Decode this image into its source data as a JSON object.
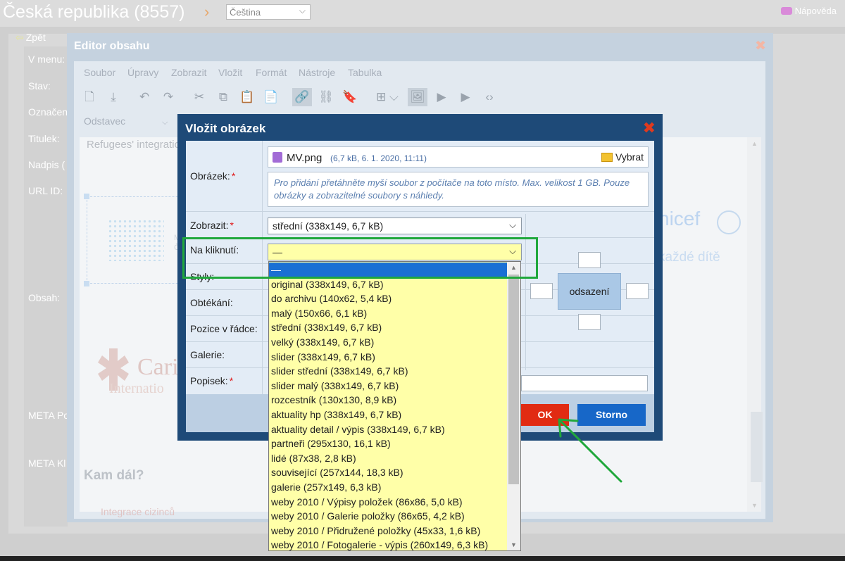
{
  "topbar": {
    "title": "Česká republika (8557)",
    "language": "Čeština",
    "help": "Nápověda"
  },
  "page": {
    "back": "Zpět",
    "labels": [
      "V menu:",
      "Stav:",
      "Označen",
      "Titulek:",
      "Nadpis (",
      "URL ID:",
      "Obsah:",
      "META Po",
      "META Kl"
    ]
  },
  "editor": {
    "title": "Editor obsahu",
    "menu": [
      "Soubor",
      "Úpravy",
      "Zobrazit",
      "Vložit",
      "Formát",
      "Nástroje",
      "Tabulka"
    ],
    "format": "Odstavec",
    "content_text": "Refugees' integratio",
    "mv_logo_text_1": "MI",
    "mv_logo_text_2": "ČE",
    "unicef": "nicef",
    "unicef_sub": "každé dítě",
    "caritas": "Cari",
    "caritas_sub": "Internatio",
    "heading": "Kam dál?",
    "link": "Integrace cizinců"
  },
  "dialog": {
    "title": "Vložit obrázek",
    "labels": {
      "image": "Obrázek:",
      "display": "Zobrazit:",
      "on_click": "Na kliknutí:",
      "styles": "Styly:",
      "wrap": "Obtékání:",
      "position": "Pozice v řádce:",
      "gallery": "Galerie:",
      "caption": "Popisek:"
    },
    "file": {
      "name": "MV.png",
      "meta": "(6,7 kB, 6. 1. 2020, 11:11)",
      "choose": "Vybrat"
    },
    "dropzone": "Pro přidání přetáhněte myší soubor z počítače na toto místo. Max. velikost 1 GB. Pouze obrázky a zobrazitelné soubory s náhledy.",
    "display_value": "střední (338x149, 6,7 kB)",
    "on_click_value": "—",
    "margin_label": "odsazení",
    "ok": "OK",
    "cancel": "Storno"
  },
  "dropdown": {
    "selected_index": 0,
    "options": [
      "—",
      "original (338x149, 6,7 kB)",
      "do archivu (140x62, 5,4 kB)",
      "malý (150x66, 6,1 kB)",
      "střední (338x149, 6,7 kB)",
      "velký (338x149, 6,7 kB)",
      "slider (338x149, 6,7 kB)",
      "slider střední (338x149, 6,7 kB)",
      "slider malý (338x149, 6,7 kB)",
      "rozcestník (130x130, 8,9 kB)",
      "aktuality hp (338x149, 6,7 kB)",
      "aktuality detail / výpis (338x149, 6,7 kB)",
      "partneři (295x130, 16,1 kB)",
      "lidé (87x38, 2,8 kB)",
      "související (257x144, 18,3 kB)",
      "galerie (257x149, 6,3 kB)",
      "weby 2010 / Výpisy položek (86x86, 5,0 kB)",
      "weby 2010 / Galerie položky (86x65, 4,2 kB)",
      "weby 2010 / Přidružené položky (45x33, 1,6 kB)",
      "weby 2010 / Fotogalerie - výpis (260x149, 6,3 kB)"
    ]
  },
  "colors": {
    "dialog": "#1e4a78",
    "highlight": "#20a83c",
    "ok": "#e12b12",
    "cancel": "#1767c8",
    "dropdown_bg": "#ffffa8",
    "selected": "#1a6fd4"
  }
}
